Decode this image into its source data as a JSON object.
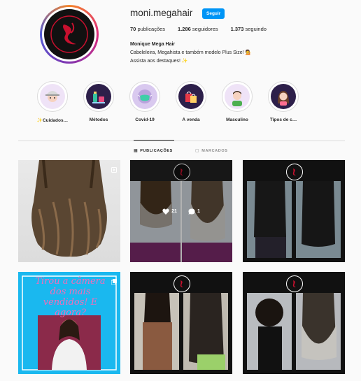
{
  "profile": {
    "username": "moni.megahair",
    "follow_label": "Seguir",
    "stats": [
      {
        "count": "70",
        "label": "publicações"
      },
      {
        "count": "1.286",
        "label": "seguidores"
      },
      {
        "count": "1.373",
        "label": "seguindo"
      }
    ],
    "bio_name": "Monique Mega Hair",
    "bio_line1": "Cabeleleira, Megahista e também modelo Plus Size! 💁",
    "bio_line2": "Assista aos destaques! ✨"
  },
  "highlights": [
    {
      "label": "✨Cuidados…",
      "icon": "hair-care-icon",
      "bg": "#efe3f7"
    },
    {
      "label": "Métodos",
      "icon": "products-icon",
      "bg": "#2d1f4a"
    },
    {
      "label": "Covid-19",
      "icon": "mask-icon",
      "bg": "#d9c9ef"
    },
    {
      "label": "À venda",
      "icon": "shopping-bag-icon",
      "bg": "#2d1f4a"
    },
    {
      "label": "Masculino",
      "icon": "man-avatar-icon",
      "bg": "#efe3f7"
    },
    {
      "label": "Tipos de c…",
      "icon": "woman-avatar-icon",
      "bg": "#2d1f4a"
    }
  ],
  "tabs": {
    "posts": "PUBLICAÇÕES",
    "tagged": "MARCADOS"
  },
  "posts": [
    {
      "type": "video"
    },
    {
      "type": "before-after",
      "likes": "21",
      "comments": "1"
    },
    {
      "type": "back-view"
    },
    {
      "type": "carousel",
      "caption": "Tirou a câmera dos mais vendidos! E agora?"
    },
    {
      "type": "before-after-short"
    },
    {
      "type": "before-after-curly"
    }
  ],
  "colors": {
    "accent": "#0095f6",
    "promo_pink": "#f46cb8",
    "promo_blue": "#1ab8ef"
  }
}
